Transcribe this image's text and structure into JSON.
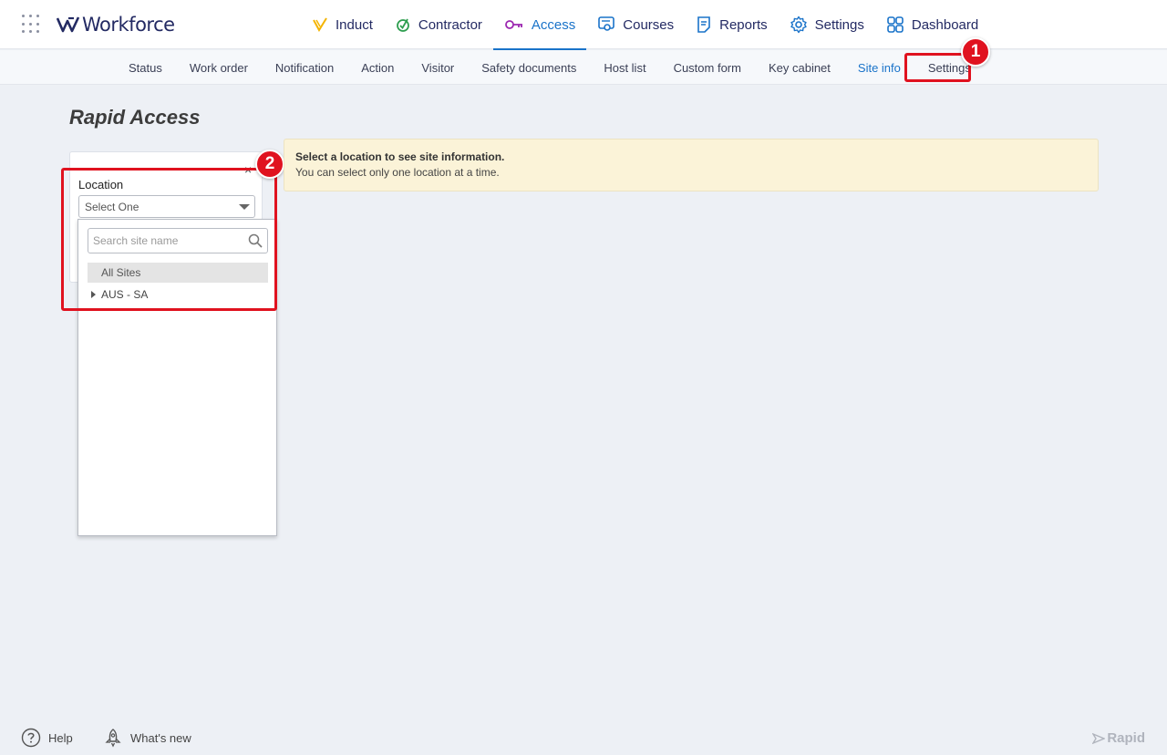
{
  "app": {
    "logo_text": "Workforce"
  },
  "main_nav": [
    {
      "label": "Induct",
      "icon": "induct-icon",
      "color": "#f4b400"
    },
    {
      "label": "Contractor",
      "icon": "contractor-icon",
      "color": "#2e9e4f"
    },
    {
      "label": "Access",
      "icon": "access-key-icon",
      "color": "#9c27b0",
      "active": true
    },
    {
      "label": "Courses",
      "icon": "courses-icon",
      "color": "#1a73c9"
    },
    {
      "label": "Reports",
      "icon": "reports-icon",
      "color": "#1a73c9"
    },
    {
      "label": "Settings",
      "icon": "gear-icon",
      "color": "#1a73c9"
    },
    {
      "label": "Dashboard",
      "icon": "dashboard-icon",
      "color": "#1a73c9"
    }
  ],
  "sub_nav": [
    {
      "label": "Status"
    },
    {
      "label": "Work order"
    },
    {
      "label": "Notification"
    },
    {
      "label": "Action"
    },
    {
      "label": "Visitor"
    },
    {
      "label": "Safety documents"
    },
    {
      "label": "Host list"
    },
    {
      "label": "Custom form"
    },
    {
      "label": "Key cabinet"
    },
    {
      "label": "Site info",
      "active": true
    },
    {
      "label": "Settings"
    }
  ],
  "annotations": {
    "badge1": "1",
    "badge2": "2",
    "color": "#e0121f"
  },
  "page_title": "Rapid Access",
  "filter": {
    "close_glyph": "×",
    "location_label": "Location",
    "select_value": "Select One",
    "search_placeholder": "Search site name",
    "all_sites": "All Sites",
    "tree_items": [
      "AUS - SA"
    ]
  },
  "info": {
    "title": "Select a location to see site information.",
    "subtitle": "You can select only one location at a time."
  },
  "footer": {
    "help": "Help",
    "whats_new": "What's new",
    "brand": "Rapid"
  }
}
